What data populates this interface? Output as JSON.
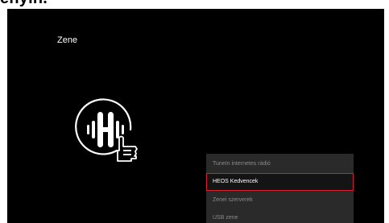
{
  "heading": "ényin.",
  "screen": {
    "title": "Zene",
    "logo_icon": "heos-logo-icon",
    "pointer_icon": "hand-pointer-icon"
  },
  "menu": {
    "items": [
      {
        "label": "TuneIn internetes rádió"
      },
      {
        "label": "HEOS Kedvencek"
      },
      {
        "label": "Zenei szerverek"
      },
      {
        "label": "USB zene"
      }
    ],
    "selected_index": 1
  },
  "colors": {
    "screen_background": "#000000",
    "menu_background": "#2a2a2a",
    "selection_border": "#d4202b",
    "text_active": "#ffffff",
    "text_inactive": "#8a8a8a"
  }
}
